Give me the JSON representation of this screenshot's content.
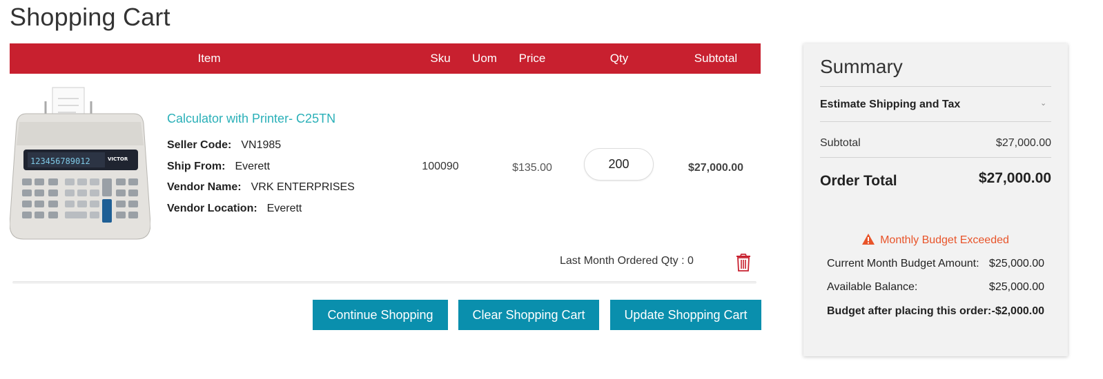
{
  "page": {
    "title": "Shopping Cart"
  },
  "cart": {
    "columns": {
      "item": "Item",
      "sku": "Sku",
      "uom": "Uom",
      "price": "Price",
      "qty": "Qty",
      "subtotal": "Subtotal"
    },
    "row": {
      "name": "Calculator with Printer- C25TN",
      "seller_code_label": "Seller Code:",
      "seller_code": "VN1985",
      "ship_from_label": "Ship From:",
      "ship_from": "Everett",
      "vendor_name_label": "Vendor Name:",
      "vendor_name": "VRK ENTERPRISES",
      "vendor_location_label": "Vendor Location:",
      "vendor_location": "Everett",
      "sku": "100090",
      "price": "$135.00",
      "qty": "200",
      "subtotal": "$27,000.00",
      "last_month": "Last Month Ordered Qty : 0",
      "display_digits": "123456789012",
      "brand_text": "VICTOR"
    },
    "buttons": {
      "continue": "Continue Shopping",
      "clear": "Clear Shopping Cart",
      "update": "Update Shopping Cart"
    }
  },
  "summary": {
    "title": "Summary",
    "estimate": "Estimate Shipping and Tax",
    "subtotal_label": "Subtotal",
    "subtotal": "$27,000.00",
    "order_total_label": "Order Total",
    "order_total": "$27,000.00",
    "alert": "Monthly Budget Exceeded",
    "budget_rows": [
      {
        "label": "Current Month Budget Amount:",
        "value": "$25,000.00"
      },
      {
        "label": "Available Balance:",
        "value": "$25,000.00"
      },
      {
        "label": "Budget after placing this order:",
        "value": "-$2,000.00"
      }
    ]
  },
  "colors": {
    "header": "#c8202f",
    "button": "#0a8fad",
    "link": "#2ab0b8",
    "alert": "#e8542a",
    "trash": "#c8202f"
  }
}
